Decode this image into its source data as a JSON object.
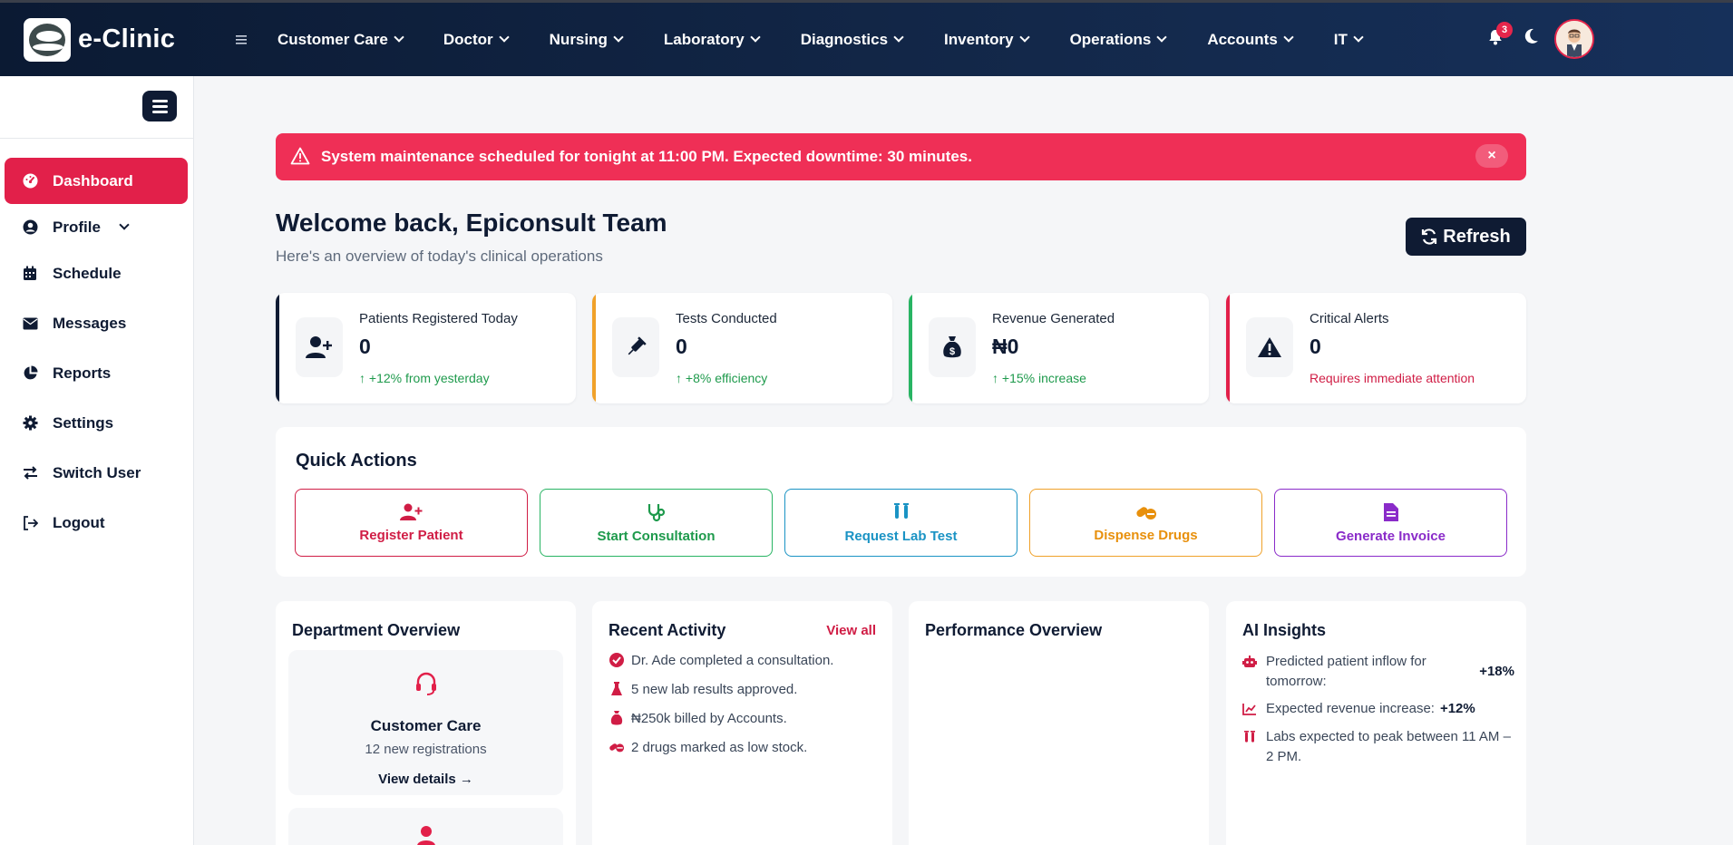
{
  "app": {
    "brand": "e-Clinic"
  },
  "topnav": {
    "items": [
      "Customer Care",
      "Doctor",
      "Nursing",
      "Laboratory",
      "Diagnostics",
      "Inventory",
      "Operations",
      "Accounts",
      "IT"
    ],
    "notification_count": "3"
  },
  "sidebar": {
    "items": [
      {
        "label": "Dashboard",
        "icon": "gauge-icon"
      },
      {
        "label": "Profile",
        "icon": "user-circle-icon"
      },
      {
        "label": "Schedule",
        "icon": "calendar-icon"
      },
      {
        "label": "Messages",
        "icon": "envelope-icon"
      },
      {
        "label": "Reports",
        "icon": "pie-chart-icon"
      },
      {
        "label": "Settings",
        "icon": "gear-icon"
      },
      {
        "label": "Switch User",
        "icon": "swap-arrows-icon"
      },
      {
        "label": "Logout",
        "icon": "logout-icon"
      }
    ]
  },
  "alert": {
    "text": "System maintenance scheduled for tonight at 11:00 PM. Expected downtime: 30 minutes.",
    "close": "×"
  },
  "header": {
    "welcome": "Welcome back, Epiconsult Team",
    "subtitle": "Here's an overview of today's clinical operations",
    "refresh": "Refresh"
  },
  "stats": [
    {
      "label": "Patients Registered Today",
      "value": "0",
      "trend": "+12% from yesterday",
      "color": "#0f1b33",
      "icon": "user-plus-icon"
    },
    {
      "label": "Tests Conducted",
      "value": "0",
      "trend": "+8% efficiency",
      "color": "#f0a12a",
      "icon": "syringe-icon"
    },
    {
      "label": "Revenue Generated",
      "value": "₦0",
      "trend": "+15% increase",
      "color": "#28b463",
      "icon": "money-bag-icon"
    },
    {
      "label": "Critical Alerts",
      "value": "0",
      "trend": "Requires immediate attention",
      "color": "#e2204a",
      "icon": "warning-icon"
    }
  ],
  "quick_actions": {
    "title": "Quick Actions",
    "buttons": [
      {
        "label": "Register Patient",
        "color": "#d01d45"
      },
      {
        "label": "Start Consultation",
        "color": "#1e9a4c"
      },
      {
        "label": "Request Lab Test",
        "color": "#1a93c4"
      },
      {
        "label": "Dispense Drugs",
        "color": "#e8900c"
      },
      {
        "label": "Generate Invoice",
        "color": "#8a2bc9"
      }
    ]
  },
  "department": {
    "title": "Department Overview",
    "name": "Customer Care",
    "sub": "12 new registrations",
    "link": "View details →"
  },
  "activity": {
    "title": "Recent Activity",
    "view_all": "View all",
    "items": [
      "Dr. Ade completed a consultation.",
      "5 new lab results approved.",
      "₦250k billed by Accounts.",
      "2 drugs marked as low stock."
    ]
  },
  "performance": {
    "title": "Performance Overview"
  },
  "insights": {
    "title": "AI Insights",
    "items": [
      {
        "text": "Predicted patient inflow for tomorrow:",
        "value": "+18%"
      },
      {
        "text": "Expected revenue increase:",
        "value": "+12%"
      },
      {
        "text": "Labs expected to peak between 11 AM – 2 PM.",
        "value": ""
      }
    ]
  },
  "colors": {
    "accent": "#e2204a",
    "navy": "#0f1b33"
  }
}
